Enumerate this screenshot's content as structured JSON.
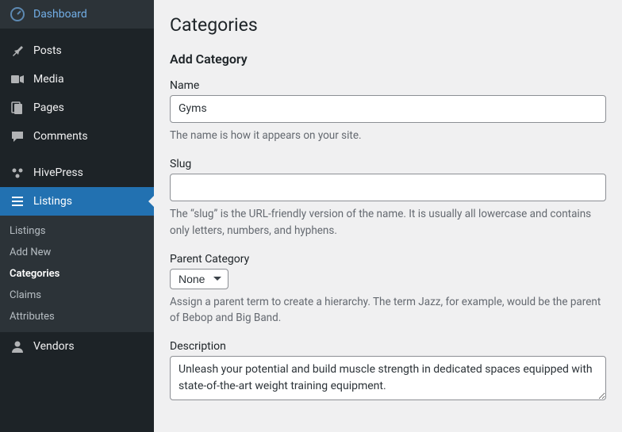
{
  "sidebar": {
    "items": [
      {
        "label": "Dashboard",
        "icon": "dashboard"
      },
      {
        "label": "Posts",
        "icon": "pin"
      },
      {
        "label": "Media",
        "icon": "media"
      },
      {
        "label": "Pages",
        "icon": "pages"
      },
      {
        "label": "Comments",
        "icon": "comment"
      },
      {
        "label": "HivePress",
        "icon": "hivepress"
      },
      {
        "label": "Listings",
        "icon": "listings",
        "active": true
      },
      {
        "label": "Vendors",
        "icon": "vendors"
      }
    ],
    "submenu": [
      {
        "label": "Listings"
      },
      {
        "label": "Add New"
      },
      {
        "label": "Categories",
        "current": true
      },
      {
        "label": "Claims"
      },
      {
        "label": "Attributes"
      }
    ]
  },
  "page": {
    "title": "Categories",
    "formTitle": "Add Category"
  },
  "fields": {
    "name": {
      "label": "Name",
      "value": "Gyms",
      "desc": "The name is how it appears on your site."
    },
    "slug": {
      "label": "Slug",
      "value": "",
      "desc": "The “slug” is the URL-friendly version of the name. It is usually all lowercase and contains only letters, numbers, and hyphens."
    },
    "parent": {
      "label": "Parent Category",
      "selected": "None",
      "desc": "Assign a parent term to create a hierarchy. The term Jazz, for example, would be the parent of Bebop and Big Band."
    },
    "description": {
      "label": "Description",
      "value": "Unleash your potential and build muscle strength in dedicated spaces equipped with state-of-the-art weight training equipment."
    }
  }
}
